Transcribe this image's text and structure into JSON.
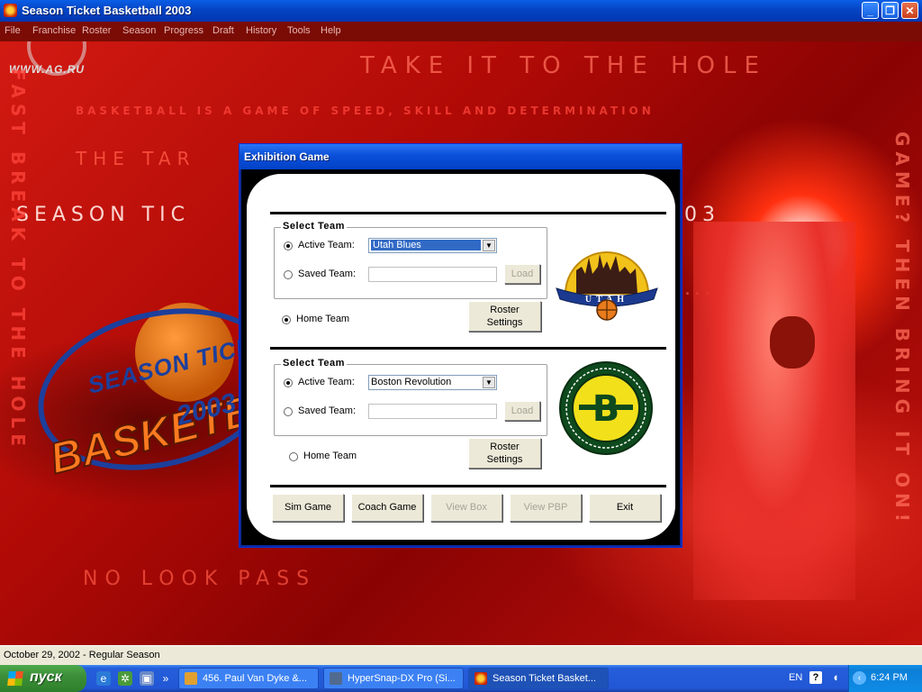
{
  "window": {
    "title": "Season Ticket Basketball 2003",
    "controls": {
      "minimize": "_",
      "restore": "❐",
      "close": "✕"
    }
  },
  "menu": [
    "File",
    "Franchise",
    "Roster",
    "Season",
    "Progress",
    "Draft",
    "History",
    "Tools",
    "Help"
  ],
  "background": {
    "watermark": "WWW.AG.RU",
    "headline": "TAKE IT TO THE HOLE",
    "tagline": "BASKETBALL IS A GAME OF SPEED, SKILL AND DETERMINATION",
    "line3": "THE TAR",
    "line4": "SEASON TIC",
    "line4_tail": "03",
    "ellipsis": "...",
    "bottom": "NO LOOK PASS",
    "left_vertical": "FAST BREAK TO THE HOLE",
    "right_vertical": "GAME? THEN BRING IT ON!",
    "logo": {
      "top": "SEASON TICKET",
      "main": "BASKETBALL",
      "year": "2003"
    }
  },
  "dialog": {
    "title": "Exhibition Game",
    "team1": {
      "group_title": "Select Team",
      "active_label": "Active Team:",
      "active_value": "Utah Blues",
      "saved_label": "Saved Team:",
      "saved_value": "",
      "load_label": "Load",
      "home_label": "Home Team",
      "home_selected": true,
      "roster_line1": "Roster",
      "roster_line2": "Settings",
      "logo_text": "UTAH"
    },
    "team2": {
      "group_title": "Select Team",
      "active_label": "Active Team:",
      "active_value": "Boston Revolution",
      "saved_label": "Saved Team:",
      "saved_value": "",
      "load_label": "Load",
      "home_label": "Home Team",
      "home_selected": false,
      "roster_line1": "Roster",
      "roster_line2": "Settings",
      "logo_text": "B"
    },
    "buttons": {
      "sim": "Sim Game",
      "coach": "Coach Game",
      "view_box": "View Box",
      "view_pbp": "View PBP",
      "exit": "Exit"
    }
  },
  "status": {
    "text": "October 29, 2002 - Regular Season"
  },
  "taskbar": {
    "start": "пуск",
    "tasks": [
      {
        "label": "456. Paul Van Dyke &...",
        "active": false
      },
      {
        "label": "HyperSnap-DX Pro (Si...",
        "active": false
      },
      {
        "label": "Season Ticket Basket...",
        "active": true
      }
    ],
    "language": "EN",
    "help": "?",
    "clock": "6:24 PM",
    "overflow": "»"
  },
  "colors": {
    "titlebar": "#0544c4",
    "menubar": "#7a0c05",
    "dialog_panel": "#ffffff",
    "selection": "#316ac5",
    "taskbar": "#245edb",
    "start": "#3c8f39"
  }
}
